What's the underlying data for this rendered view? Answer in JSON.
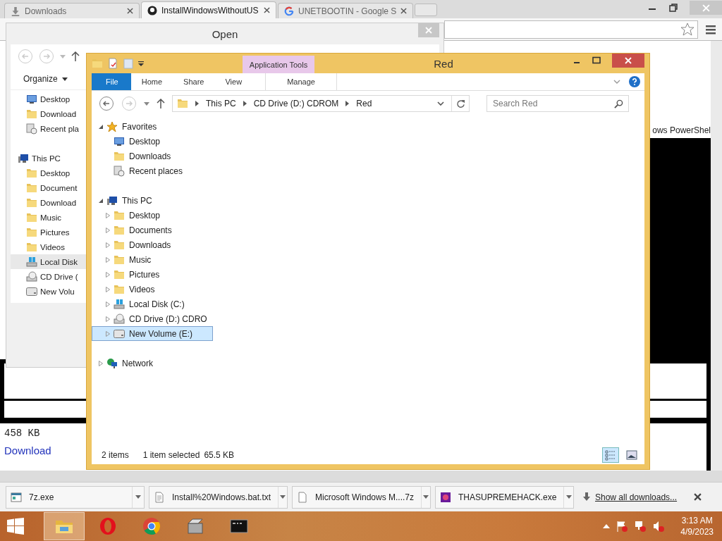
{
  "browser": {
    "tabs": [
      {
        "title": "Downloads",
        "selected": false
      },
      {
        "title": "InstallWindowsWithoutUS",
        "selected": true
      },
      {
        "title": "UNETBOOTIN - Google S",
        "selected": false
      }
    ],
    "page": {
      "heading": "ows PowerShel",
      "size": "458  KB",
      "link": "Download"
    }
  },
  "open_dialog": {
    "title": "Open",
    "organize": "Organize",
    "favorites": [
      {
        "label": "Desktop",
        "kind": "desktop",
        "selected": false
      },
      {
        "label": "Download",
        "kind": "folder",
        "selected": false
      },
      {
        "label": "Recent pla",
        "kind": "recent",
        "selected": false
      }
    ],
    "this_pc": {
      "label": "This PC",
      "kind": "pc",
      "children": [
        {
          "label": "Desktop",
          "kind": "folder",
          "selected": false
        },
        {
          "label": "Document",
          "kind": "folder",
          "selected": false
        },
        {
          "label": "Download",
          "kind": "folder",
          "selected": false
        },
        {
          "label": "Music",
          "kind": "folder",
          "selected": false
        },
        {
          "label": "Pictures",
          "kind": "folder",
          "selected": false
        },
        {
          "label": "Videos",
          "kind": "folder",
          "selected": false
        },
        {
          "label": "Local Disk",
          "kind": "disk",
          "selected": true
        },
        {
          "label": "CD Drive (",
          "kind": "cd",
          "selected": false
        },
        {
          "label": "New Volu",
          "kind": "drive",
          "selected": false
        }
      ]
    }
  },
  "explorer": {
    "title": "Red",
    "context_tab": "Application Tools",
    "ribbon_tabs": [
      {
        "label": "File",
        "kind": "file"
      },
      {
        "label": "Home",
        "kind": "tab"
      },
      {
        "label": "Share",
        "kind": "tab"
      },
      {
        "label": "View",
        "kind": "tab"
      },
      {
        "label": "Manage",
        "kind": "context"
      }
    ],
    "address": [
      "This PC",
      "CD Drive (D:) CDROM",
      "Red"
    ],
    "search": {
      "placeholder": "Search Red"
    },
    "tree": [
      {
        "label": "Favorites",
        "kind": "star",
        "expanded": true,
        "selected": false,
        "children": [
          {
            "label": "Desktop",
            "kind": "desktop",
            "selected": false
          },
          {
            "label": "Downloads",
            "kind": "folder",
            "selected": false
          },
          {
            "label": "Recent places",
            "kind": "recent",
            "selected": false
          }
        ]
      },
      {
        "label": "This PC",
        "kind": "pc",
        "expanded": true,
        "selected": false,
        "children": [
          {
            "label": "Desktop",
            "kind": "folder",
            "expanded": false,
            "selected": false
          },
          {
            "label": "Documents",
            "kind": "folder",
            "expanded": false,
            "selected": false
          },
          {
            "label": "Downloads",
            "kind": "folder",
            "expanded": false,
            "selected": false
          },
          {
            "label": "Music",
            "kind": "folder",
            "expanded": false,
            "selected": false
          },
          {
            "label": "Pictures",
            "kind": "folder",
            "expanded": false,
            "selected": false
          },
          {
            "label": "Videos",
            "kind": "folder",
            "expanded": false,
            "selected": false
          },
          {
            "label": "Local Disk (C:)",
            "kind": "disk",
            "expanded": false,
            "selected": false
          },
          {
            "label": "CD Drive (D:) CDRO",
            "kind": "cd",
            "expanded": false,
            "selected": false
          },
          {
            "label": "New Volume (E:)",
            "kind": "drive",
            "expanded": false,
            "selected": true
          }
        ]
      },
      {
        "label": "Network",
        "kind": "network",
        "expanded": false,
        "selected": false
      }
    ],
    "status": {
      "count": "2 items",
      "selection": "1 item selected",
      "size": "65.5 KB"
    },
    "views": [
      {
        "kind": "details",
        "selected": true
      },
      {
        "kind": "large",
        "selected": false
      }
    ]
  },
  "downloads": {
    "items": [
      {
        "name": "7z.exe",
        "kind": "app"
      },
      {
        "name": "Install%20Windows.bat.txt",
        "kind": "text"
      },
      {
        "name": "Microsoft Windows M....7z",
        "kind": "file"
      },
      {
        "name": "THASUPREMEHACK.exe",
        "kind": "program"
      }
    ],
    "show_all": "Show all downloads..."
  },
  "taskbar": {
    "apps": [
      {
        "kind": "explorer",
        "active": true
      },
      {
        "kind": "opera",
        "active": false
      },
      {
        "kind": "chrome",
        "active": false
      },
      {
        "kind": "installer",
        "active": false
      },
      {
        "kind": "console",
        "active": false
      }
    ],
    "time": "3:13 AM",
    "date": "4/9/2023"
  }
}
